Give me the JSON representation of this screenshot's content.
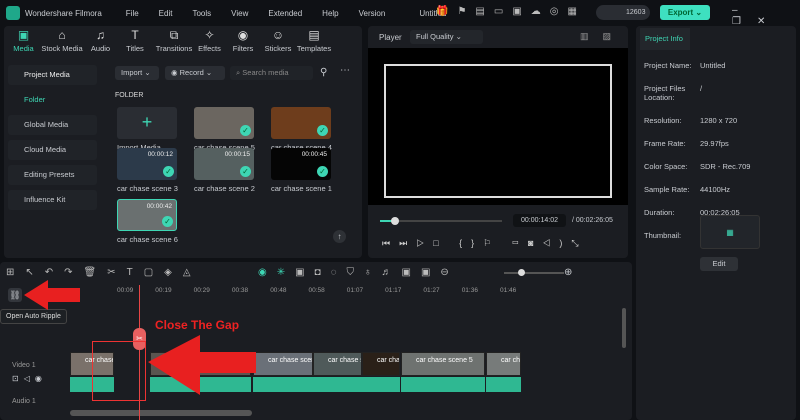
{
  "app": {
    "name": "Wondershare Filmora",
    "menu": [
      "File",
      "Edit",
      "Tools",
      "View",
      "Extended",
      "Help",
      "Version"
    ],
    "project": "Untitled",
    "credits": "12603",
    "export": "Export"
  },
  "tabs": [
    {
      "label": "Media",
      "icon": "▣"
    },
    {
      "label": "Stock Media",
      "icon": "⌂"
    },
    {
      "label": "Audio",
      "icon": "♫"
    },
    {
      "label": "Titles",
      "icon": "T"
    },
    {
      "label": "Transitions",
      "icon": "⧉"
    },
    {
      "label": "Effects",
      "icon": "✧"
    },
    {
      "label": "Filters",
      "icon": "◉"
    },
    {
      "label": "Stickers",
      "icon": "☺"
    },
    {
      "label": "Templates",
      "icon": "▤"
    }
  ],
  "sidebar": [
    "Project Media",
    "Folder",
    "Global Media",
    "Cloud Media",
    "Editing Presets",
    "Influence Kit"
  ],
  "media": {
    "import": "Import",
    "record": "Record",
    "search_placeholder": "Search media",
    "folder": "FOLDER",
    "items": [
      {
        "label": "Import Media",
        "dur": ""
      },
      {
        "label": "car chase scene 5",
        "dur": ""
      },
      {
        "label": "car chase scene 4",
        "dur": ""
      },
      {
        "label": "car chase scene 3",
        "dur": "00:00:12"
      },
      {
        "label": "car chase scene 2",
        "dur": "00:00:15"
      },
      {
        "label": "car chase scene 1",
        "dur": "00:00:45"
      },
      {
        "label": "car chase scene 6",
        "dur": "00:00:42"
      }
    ]
  },
  "player": {
    "label": "Player",
    "quality": "Full Quality",
    "current": "00:00:14:02",
    "total": "/ 00:02:26:05",
    "progress": 0.1
  },
  "info": {
    "tab": "Project Info",
    "rows": [
      [
        "Project Name:",
        "Untitled"
      ],
      [
        "Project Files Location:",
        "/"
      ],
      [
        "Resolution:",
        "1280 x 720"
      ],
      [
        "Frame Rate:",
        "29.97fps"
      ],
      [
        "Color Space:",
        "SDR - Rec.709"
      ],
      [
        "Sample Rate:",
        "44100Hz"
      ],
      [
        "Duration:",
        "00:02:26:05"
      ]
    ],
    "thumb": "Thumbnail:",
    "edit": "Edit"
  },
  "timeline": {
    "ticks": [
      "00:09",
      "00:19",
      "00:29",
      "00:38",
      "00:48",
      "00:58",
      "01:07",
      "01:17",
      "01:27",
      "01:36",
      "01:46"
    ],
    "tooltip": "Open Auto Ripple",
    "annotation": "Close The Gap",
    "video_track": "Video 1",
    "audio_track": "Audio 1",
    "clips": [
      "car chase...",
      "car chase scene",
      "car chase scen...",
      "car chase s...",
      "car cha...",
      "car chase scene 5",
      "car cha"
    ]
  }
}
